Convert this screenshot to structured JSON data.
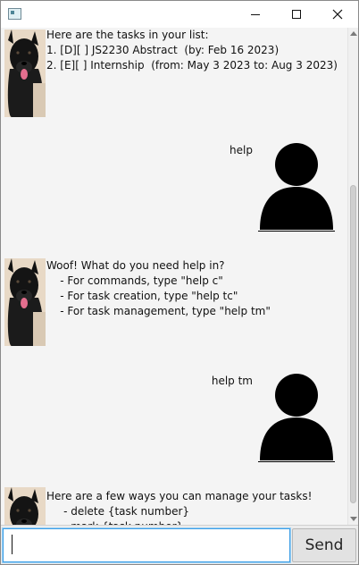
{
  "window": {
    "controls": {
      "minimize": "minimize",
      "maximize": "maximize",
      "close": "close"
    }
  },
  "messages": [
    {
      "sender": "bot",
      "text": "Here are the tasks in your list:\n1. [D][ ] JS2230 Abstract  (by: Feb 16 2023)\n2. [E][ ] Internship  (from: May 3 2023 to: Aug 3 2023)"
    },
    {
      "sender": "user",
      "text": "help"
    },
    {
      "sender": "bot",
      "text": "Woof! What do you need help in?\n    - For commands, type \"help c\"\n    - For task creation, type \"help tc\"\n    - For task management, type \"help tm\""
    },
    {
      "sender": "user",
      "text": "help tm"
    },
    {
      "sender": "bot",
      "text": "Here are a few ways you can manage your tasks!\n     - delete {task number}\n     - mark {task number}"
    }
  ],
  "input": {
    "value": "",
    "placeholder": ""
  },
  "send_label": "Send",
  "icons": {
    "bot_avatar": "dog-avatar-icon",
    "user_avatar": "user-silhouette-icon"
  }
}
